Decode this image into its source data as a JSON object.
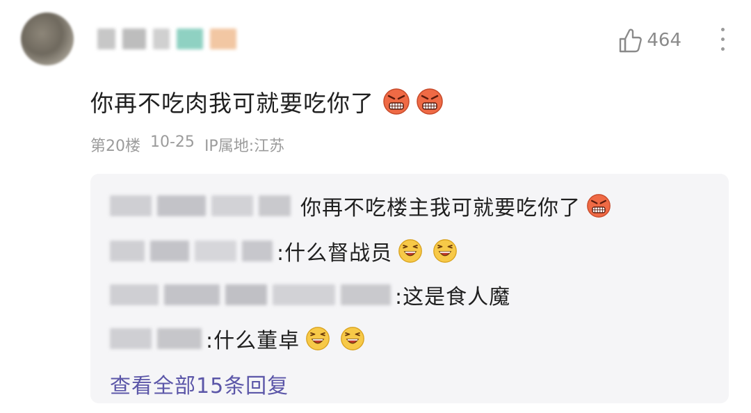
{
  "comment": {
    "likes": "464",
    "text": "你再不吃肉我可就要吃你了",
    "floor": "第20楼",
    "date": "10-25",
    "ip": "IP属地:江苏"
  },
  "replies": [
    {
      "text": "你再不吃楼主我可就要吃你了"
    },
    {
      "text": ":什么督战员"
    },
    {
      "text": ":这是食人魔"
    },
    {
      "text": ":什么董卓"
    }
  ],
  "view_all": "查看全部15条回复",
  "icons": {
    "like": "thumbs-up-icon",
    "more": "more-vertical-icon",
    "angry": "angry-face-emoji",
    "laugh": "laughing-face-emoji"
  }
}
